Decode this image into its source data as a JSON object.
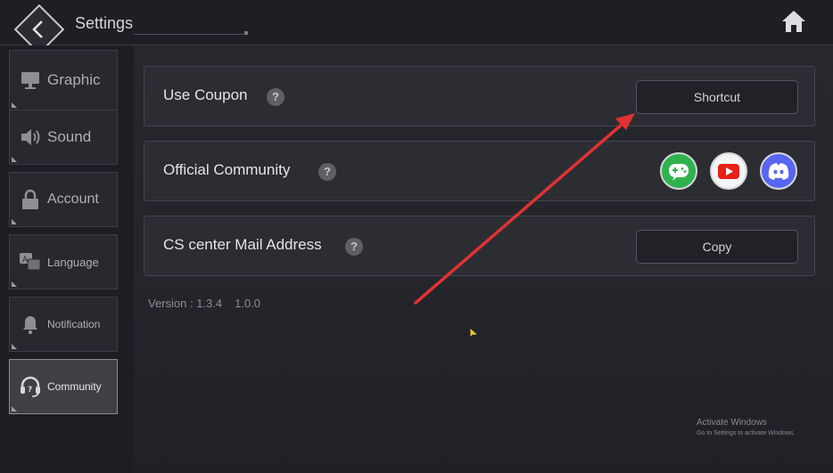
{
  "header": {
    "title": "Settings",
    "back_icon": "back-arrow-icon",
    "home_icon": "home-icon"
  },
  "sidebar": {
    "items": [
      {
        "label": "Graphic",
        "icon": "monitor-icon",
        "active": false
      },
      {
        "label": "Sound",
        "icon": "speaker-icon",
        "active": false
      },
      {
        "label": "Account",
        "icon": "lock-icon",
        "active": false
      },
      {
        "label": "Language",
        "icon": "translate-icon",
        "active": false
      },
      {
        "label": "Notification",
        "icon": "bell-icon",
        "active": false
      },
      {
        "label": "Community",
        "icon": "headset-icon",
        "active": true
      }
    ]
  },
  "main": {
    "rows": [
      {
        "label": "Use Coupon",
        "help": "?",
        "button": "Shortcut"
      },
      {
        "label": "Official Community",
        "help": "?"
      },
      {
        "label": "CS center Mail Address",
        "help": "?",
        "button": "Copy"
      }
    ],
    "social": [
      {
        "name": "game-chat-icon",
        "color": "#2fb24c"
      },
      {
        "name": "youtube-icon",
        "color": "#e62117"
      },
      {
        "name": "discord-icon",
        "color": "#5865f2"
      }
    ],
    "version_label": "Version : 1.3.4",
    "version_second": "1.0.0"
  },
  "overlay": {
    "activate_title": "Activate Windows",
    "activate_sub": "Go to Settings to activate Windows.",
    "arrow_color": "#e03232"
  }
}
